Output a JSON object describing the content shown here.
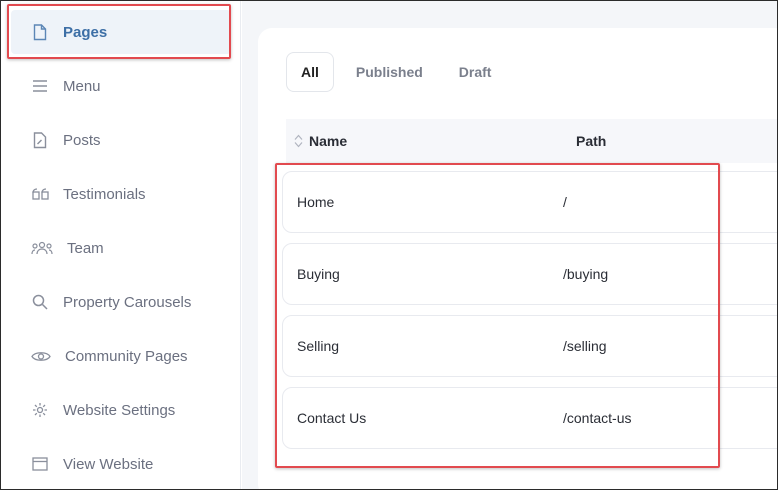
{
  "sidebar": {
    "items": [
      {
        "label": "Pages",
        "icon": "file-icon"
      },
      {
        "label": "Menu",
        "icon": "menu-icon"
      },
      {
        "label": "Posts",
        "icon": "file-edit-icon"
      },
      {
        "label": "Testimonials",
        "icon": "quote-icon"
      },
      {
        "label": "Team",
        "icon": "team-icon"
      },
      {
        "label": "Property Carousels",
        "icon": "search-icon"
      },
      {
        "label": "Community Pages",
        "icon": "eye-icon"
      },
      {
        "label": "Website Settings",
        "icon": "gear-icon"
      },
      {
        "label": "View Website",
        "icon": "window-icon"
      }
    ]
  },
  "tabs": [
    {
      "label": "All"
    },
    {
      "label": "Published"
    },
    {
      "label": "Draft"
    }
  ],
  "table": {
    "headers": {
      "name": "Name",
      "path": "Path"
    },
    "rows": [
      {
        "name": "Home",
        "path": "/"
      },
      {
        "name": "Buying",
        "path": "/buying"
      },
      {
        "name": "Selling",
        "path": "/selling"
      },
      {
        "name": "Contact Us",
        "path": "/contact-us"
      }
    ]
  },
  "colors": {
    "accent": "#3d6fa6",
    "highlight": "#e24a4f",
    "active_bg": "#eef3f9"
  }
}
